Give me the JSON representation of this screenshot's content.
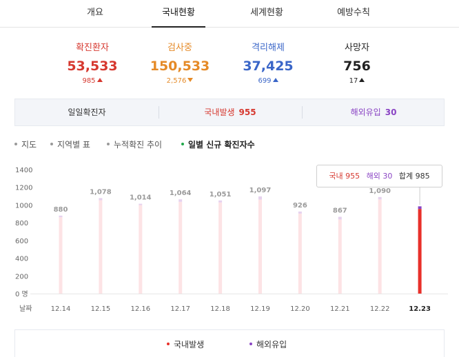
{
  "tabs": [
    {
      "label": "개요"
    },
    {
      "label": "국내현황"
    },
    {
      "label": "세계현황"
    },
    {
      "label": "예방수칙"
    }
  ],
  "stats": [
    {
      "label": "확진환자",
      "value": "53,533",
      "change": "985",
      "direction": "up",
      "color": "#d6382f"
    },
    {
      "label": "검사중",
      "value": "150,533",
      "change": "2,576",
      "direction": "down",
      "color": "#e58a27"
    },
    {
      "label": "격리해제",
      "value": "37,425",
      "change": "699",
      "direction": "up",
      "color": "#3a66c8"
    },
    {
      "label": "사망자",
      "value": "756",
      "change": "17",
      "direction": "up",
      "color": "#222222"
    }
  ],
  "daily": {
    "title": "일일확진자",
    "domestic_label": "국내발생",
    "domestic_value": "955",
    "overseas_label": "해외유입",
    "overseas_value": "30"
  },
  "subnav": [
    {
      "label": "지도"
    },
    {
      "label": "지역별 표"
    },
    {
      "label": "누적확진 추이"
    },
    {
      "label": "일별 신규 확진자수"
    }
  ],
  "tooltip": {
    "domestic_label": "국내",
    "domestic_value": "955",
    "overseas_label": "해외",
    "overseas_value": "30",
    "total_label": "합계",
    "total_value": "985"
  },
  "legend": {
    "domestic": "국내발생",
    "overseas": "해외유입"
  },
  "colors": {
    "domestic": "#e8302a",
    "overseas": "#8a44c4",
    "bar_faded": "#fde3e5",
    "bar_faded_top": "#e6d2ee",
    "label_gray": "#9a9a9a"
  },
  "chart_data": {
    "type": "bar",
    "stacked": true,
    "xlabel": "날짜",
    "ylabel": "",
    "y_unit": "명",
    "ylim": [
      0,
      1400
    ],
    "yticks": [
      "0 명",
      "200",
      "400",
      "600",
      "800",
      "1000",
      "1200",
      "1400"
    ],
    "categories": [
      "12.14",
      "12.15",
      "12.16",
      "12.17",
      "12.18",
      "12.19",
      "12.20",
      "12.21",
      "12.22",
      "12.23"
    ],
    "totals": [
      880,
      1078,
      1014,
      1064,
      1051,
      1097,
      926,
      867,
      1090,
      985
    ],
    "series": [
      {
        "name": "국내발생",
        "values": [
          862,
          1054,
          999,
          1036,
          1029,
          1062,
          903,
          837,
          1063,
          955
        ]
      },
      {
        "name": "해외유입",
        "values": [
          18,
          24,
          15,
          28,
          22,
          35,
          23,
          30,
          27,
          30
        ]
      }
    ],
    "highlight_index": 9,
    "grid": false,
    "legend_position": "bottom"
  }
}
